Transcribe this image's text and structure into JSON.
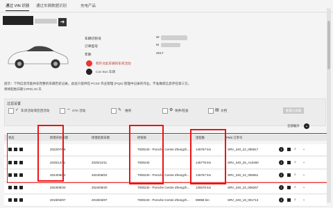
{
  "tabs": [
    {
      "label": "通过 VIN 识别",
      "active": true
    },
    {
      "label": "通过车辆数据识别",
      "active": false
    },
    {
      "label": "充电产品",
      "active": false
    }
  ],
  "vehicle": {
    "fields": [
      {
        "label": "车辆识别号",
        "value": "W"
      },
      {
        "label": "订单型号",
        "value": "M"
      },
      {
        "label": "年款",
        "value": "2017"
      }
    ],
    "warning": "有针对此车辆的车间活动",
    "service_label": "Can Bus 车辆"
  },
  "notes": [
    "提示：下列信息可能并非完整的车辆历史记录。此处只提供在 PCSS 作业管理 (PQS) 管理中记录的作业。不准确或信息存在第三方。",
    "保修起始日期 (VRD) 34 天"
  ],
  "filters": {
    "title": "过滤设置",
    "items": [
      {
        "label": "车间活动或召回活动",
        "icon": "check-icon"
      },
      {
        "label": "OTA 活动",
        "icon": "wifi-icon"
      },
      {
        "label": "维修",
        "icon": "wrench-icon"
      },
      {
        "label": "保养/检查",
        "icon": "gear-icon"
      },
      {
        "label": "文档",
        "icon": "document-icon"
      }
    ],
    "reset_label": "重置过滤器"
  },
  "expand_all_label": "全部展开",
  "table": {
    "headers": [
      "状态",
      "修理开始日期",
      "修理结束日期",
      "经销商",
      "里程数",
      "PMS 订单号"
    ],
    "rows": [
      {
        "start": "2022/07/06",
        "end": "",
        "dealer": "7000240 - Porsche Centre Zhengzh...",
        "mileage": "145767 km",
        "order": "SRV_240_22_005917",
        "highlight": true
      },
      {
        "start": "2025/12/11",
        "end": "2025/12/11",
        "dealer": "7000240",
        "mileage": "145776 km",
        "order": "SRV_240_25_A10460",
        "highlight": true
      },
      {
        "start": "2024/06/02",
        "end": "2024/06/02",
        "dealer": "7000240 - Porsche Centre Zhengzh...",
        "mileage": "145767 km",
        "order": "SRV_240_24_005061",
        "highlight": true
      },
      {
        "start": "2023/09/20",
        "end": "2023/09/20",
        "dealer": "7000240 - Porsche Centre Zhengzh...",
        "mileage": "126576 km",
        "order": "SRV_240_23_008257",
        "highlight": false
      },
      {
        "start": "2019/03/07",
        "end": "2019/03/07",
        "dealer": "7000240 - Porsche Centre Zhengzh...",
        "mileage": "99998 km",
        "order": "SRV_240_19_001713",
        "highlight": false
      }
    ]
  },
  "colors": {
    "accent_red": "#e11111",
    "dark": "#222222"
  }
}
